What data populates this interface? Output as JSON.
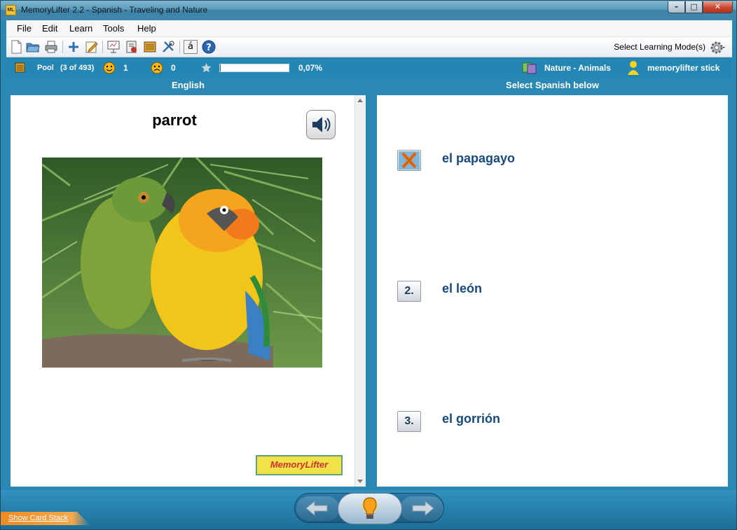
{
  "window": {
    "title": "MemoryLifter 2.2 - Spanish - Traveling and Nature",
    "app_icon_text": "ML"
  },
  "menu": [
    "File",
    "Edit",
    "Learn",
    "Tools",
    "Help"
  ],
  "toolbar": {
    "mode_label": "Select Learning Mode(s)",
    "icons": [
      "new-file-icon",
      "open-folder-icon",
      "print-icon",
      "add-card-icon",
      "edit-card-icon",
      "presentation-icon",
      "statistics-icon",
      "card-box-icon",
      "tools-icon",
      "special-char-icon",
      "help-icon"
    ],
    "special_char": "á"
  },
  "status": {
    "pool_label": "Pool",
    "pool_count": "(3 of 493)",
    "correct_count": "1",
    "wrong_count": "0",
    "progress_percent_text": "0,07%",
    "progress_fraction": 0.0007,
    "chapter": "Nature - Animals",
    "user": "memorylifter stick"
  },
  "left": {
    "header": "English",
    "word": "parrot",
    "logo_text": "MemoryLifter"
  },
  "right": {
    "header": "Select Spanish below",
    "choices": [
      {
        "button": "",
        "text": "el papagayo",
        "state": "wrong"
      },
      {
        "button": "2.",
        "text": "el león",
        "state": "normal"
      },
      {
        "button": "3.",
        "text": "el gorrión",
        "state": "normal"
      }
    ]
  },
  "bottom": {
    "show_card_stack": "Show Card Stack"
  },
  "colors": {
    "accent": "#2486b4",
    "choice_text": "#174a7c",
    "wrong_mark": "#e8751a"
  }
}
